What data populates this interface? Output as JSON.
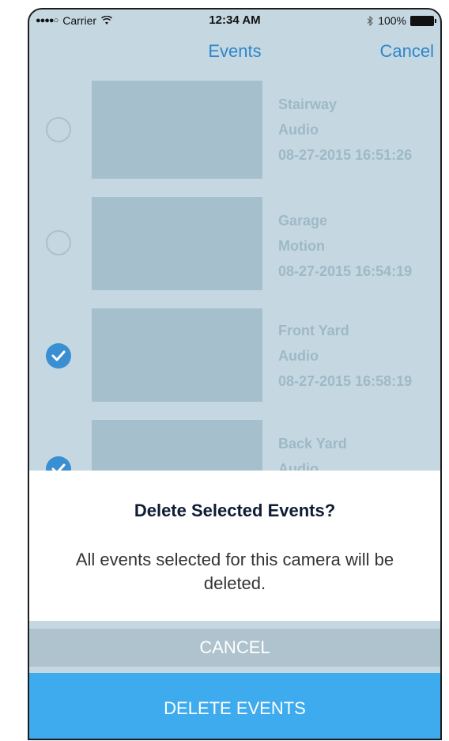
{
  "status_bar": {
    "carrier": "Carrier",
    "time": "12:34 AM",
    "battery": "100%"
  },
  "nav": {
    "title": "Events",
    "cancel_label": "Cancel"
  },
  "events": [
    {
      "name": "Stairway",
      "type": "Audio",
      "timestamp": "08-27-2015 16:51:26",
      "selected": false
    },
    {
      "name": "Garage",
      "type": "Motion",
      "timestamp": "08-27-2015 16:54:19",
      "selected": false
    },
    {
      "name": "Front Yard",
      "type": "Audio",
      "timestamp": "08-27-2015 16:58:19",
      "selected": true
    },
    {
      "name": "Back Yard",
      "type": "Audio",
      "timestamp": "",
      "selected": true
    }
  ],
  "alert": {
    "title": "Delete Selected Events?",
    "message": "All events selected for this camera will be deleted.",
    "cancel_label": "CANCEL",
    "confirm_label": "DELETE EVENTS"
  },
  "colors": {
    "accent": "#3eabef",
    "nav_text": "#2f86c9",
    "background": "#c5d8e1"
  }
}
